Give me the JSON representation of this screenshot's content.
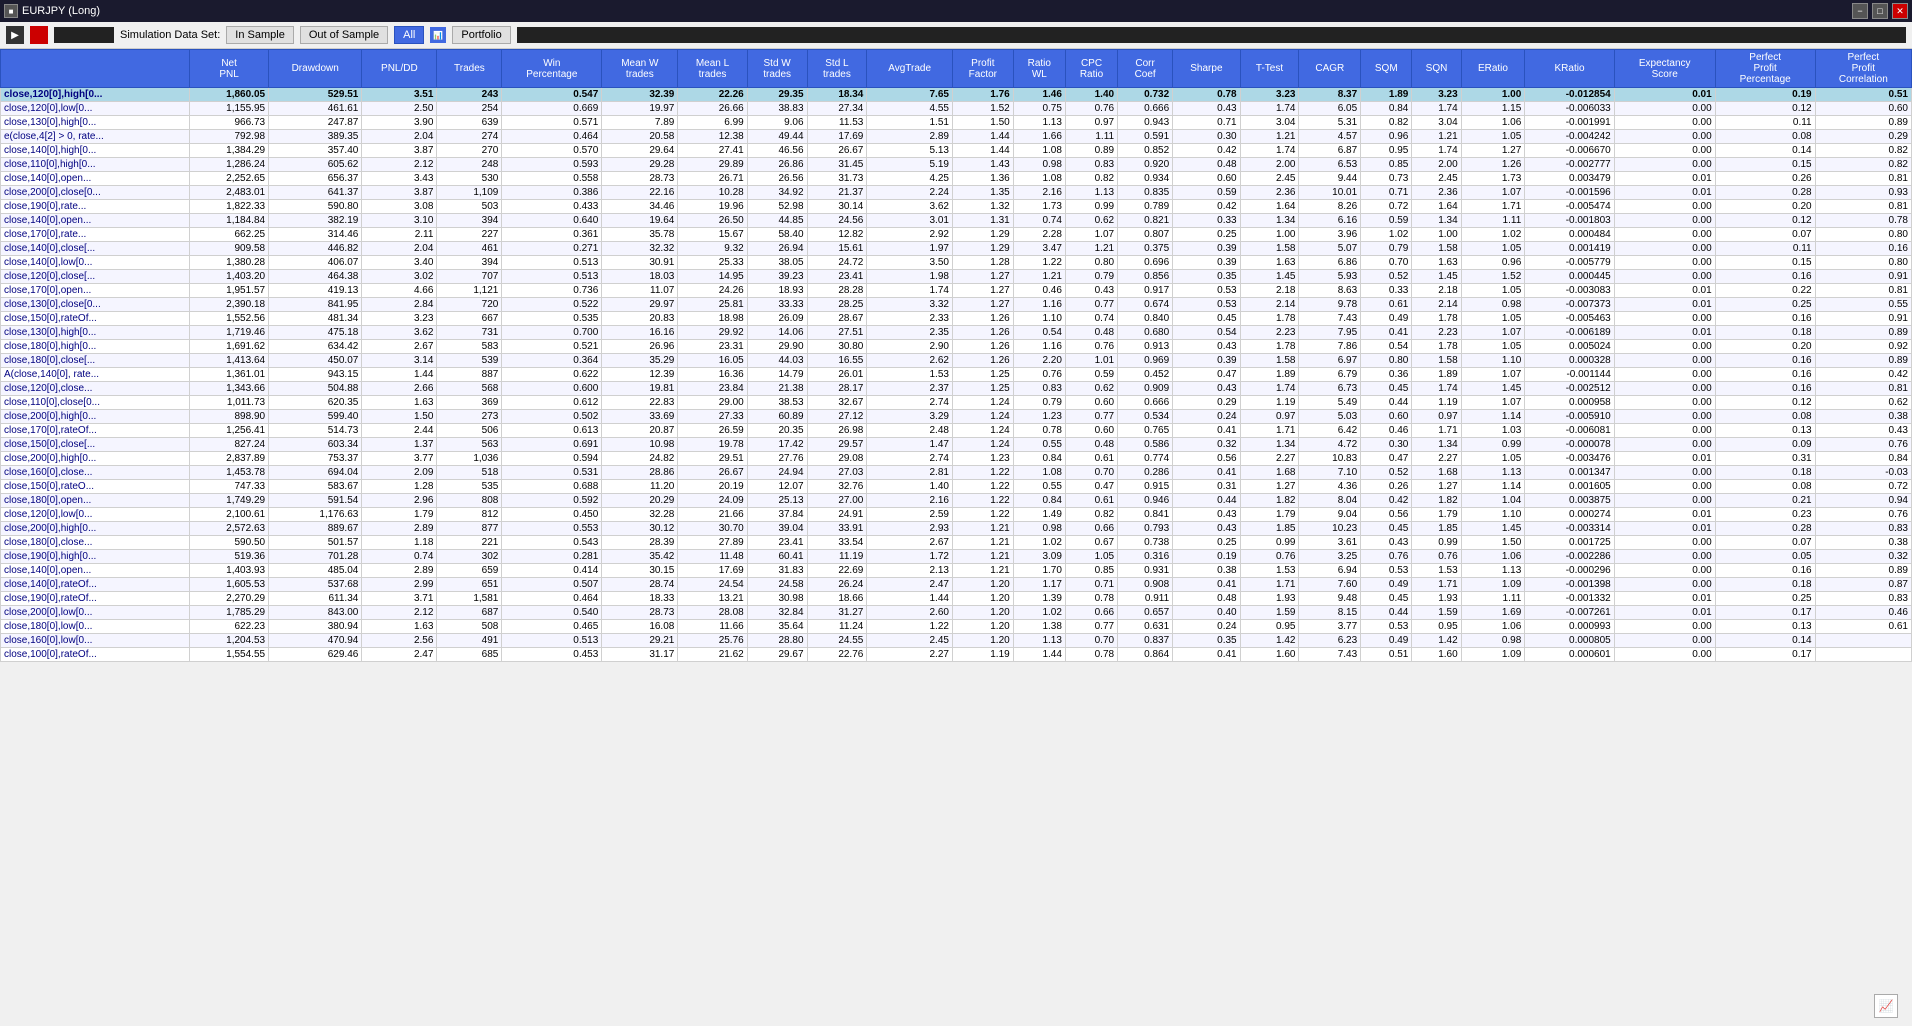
{
  "window": {
    "title": "EURJPY (Long)",
    "minimize_label": "−",
    "restore_label": "□",
    "close_label": "✕"
  },
  "toolbar": {
    "play_icon": "▶",
    "stop_color": "#cc0000",
    "sim_label": "Simulation Data Set:",
    "in_sample_label": "In Sample",
    "out_of_sample_label": "Out of Sample",
    "all_label": "All",
    "portfolio_label": "Portfolio"
  },
  "columns": [
    {
      "id": "strategy",
      "label": "",
      "sub": ""
    },
    {
      "id": "net_pnl",
      "label": "Net PNL",
      "sub": ""
    },
    {
      "id": "drawdown",
      "label": "Drawdown",
      "sub": ""
    },
    {
      "id": "pnl_dd",
      "label": "PNL/DD",
      "sub": ""
    },
    {
      "id": "trades",
      "label": "Trades",
      "sub": ""
    },
    {
      "id": "win_pct",
      "label": "Win Percentage",
      "sub": ""
    },
    {
      "id": "mean_w",
      "label": "Mean W trades",
      "sub": ""
    },
    {
      "id": "mean_l",
      "label": "Mean L trades",
      "sub": ""
    },
    {
      "id": "std_w",
      "label": "Std W trades",
      "sub": ""
    },
    {
      "id": "std_l",
      "label": "Std L trades",
      "sub": ""
    },
    {
      "id": "avg_trade",
      "label": "AvgTrade",
      "sub": ""
    },
    {
      "id": "profit_factor",
      "label": "Profit Factor",
      "sub": ""
    },
    {
      "id": "ratio_wl",
      "label": "Ratio WL",
      "sub": ""
    },
    {
      "id": "cpc_ratio",
      "label": "CPC Ratio",
      "sub": ""
    },
    {
      "id": "corr_coef",
      "label": "Corr Coef",
      "sub": ""
    },
    {
      "id": "sharpe",
      "label": "Sharpe",
      "sub": ""
    },
    {
      "id": "t_test",
      "label": "T-Test",
      "sub": ""
    },
    {
      "id": "cagr",
      "label": "CAGR",
      "sub": ""
    },
    {
      "id": "sqm",
      "label": "SQM",
      "sub": ""
    },
    {
      "id": "sqn",
      "label": "SQN",
      "sub": ""
    },
    {
      "id": "eratio",
      "label": "ERatio",
      "sub": ""
    },
    {
      "id": "kratio",
      "label": "KRatio",
      "sub": ""
    },
    {
      "id": "expectancy",
      "label": "Expectancy Score",
      "sub": ""
    },
    {
      "id": "perf_profit_pct",
      "label": "Perfect Profit Percentage",
      "sub": ""
    },
    {
      "id": "perf_profit_corr",
      "label": "Perfect Profit Correlation",
      "sub": ""
    }
  ],
  "rows": [
    [
      "close,120[0],high[0...",
      "1,860.05",
      "529.51",
      "3.51",
      "243",
      "0.547",
      "32.39",
      "22.26",
      "29.35",
      "18.34",
      "7.65",
      "1.76",
      "1.46",
      "1.40",
      "0.732",
      "0.78",
      "3.23",
      "8.37",
      "1.89",
      "3.23",
      "1.00",
      "-0.012854",
      "0.01",
      "0.19",
      "0.51"
    ],
    [
      "close,120[0],low[0...",
      "1,155.95",
      "461.61",
      "2.50",
      "254",
      "0.669",
      "19.97",
      "26.66",
      "38.83",
      "27.34",
      "4.55",
      "1.52",
      "0.75",
      "0.76",
      "0.666",
      "0.43",
      "1.74",
      "6.05",
      "0.84",
      "1.74",
      "1.15",
      "-0.006033",
      "0.00",
      "0.12",
      "0.60"
    ],
    [
      "close,130[0],high[0...",
      "966.73",
      "247.87",
      "3.90",
      "639",
      "0.571",
      "7.89",
      "6.99",
      "9.06",
      "11.53",
      "1.51",
      "1.50",
      "1.13",
      "0.97",
      "0.943",
      "0.71",
      "3.04",
      "5.31",
      "0.82",
      "3.04",
      "1.06",
      "-0.001991",
      "0.00",
      "0.11",
      "0.89"
    ],
    [
      "e(close,4[2] > 0, rate...",
      "792.98",
      "389.35",
      "2.04",
      "274",
      "0.464",
      "20.58",
      "12.38",
      "49.44",
      "17.69",
      "2.89",
      "1.44",
      "1.66",
      "1.11",
      "0.591",
      "0.30",
      "1.21",
      "4.57",
      "0.96",
      "1.21",
      "1.05",
      "-0.004242",
      "0.00",
      "0.08",
      "0.29"
    ],
    [
      "close,140[0],high[0...",
      "1,384.29",
      "357.40",
      "3.87",
      "270",
      "0.570",
      "29.64",
      "27.41",
      "46.56",
      "26.67",
      "5.13",
      "1.44",
      "1.08",
      "0.89",
      "0.852",
      "0.42",
      "1.74",
      "6.87",
      "0.95",
      "1.74",
      "1.27",
      "-0.006670",
      "0.00",
      "0.14",
      "0.82"
    ],
    [
      "close,110[0],high[0...",
      "1,286.24",
      "605.62",
      "2.12",
      "248",
      "0.593",
      "29.28",
      "29.89",
      "26.86",
      "31.45",
      "5.19",
      "1.43",
      "0.98",
      "0.83",
      "0.920",
      "0.48",
      "2.00",
      "6.53",
      "0.85",
      "2.00",
      "1.26",
      "-0.002777",
      "0.00",
      "0.15",
      "0.82"
    ],
    [
      "close,140[0],open...",
      "2,252.65",
      "656.37",
      "3.43",
      "530",
      "0.558",
      "28.73",
      "26.71",
      "26.56",
      "31.73",
      "4.25",
      "1.36",
      "1.08",
      "0.82",
      "0.934",
      "0.60",
      "2.45",
      "9.44",
      "0.73",
      "2.45",
      "1.73",
      "0.003479",
      "0.01",
      "0.26",
      "0.81"
    ],
    [
      "close,200[0],close[0...",
      "2,483.01",
      "641.37",
      "3.87",
      "1,109",
      "0.386",
      "22.16",
      "10.28",
      "34.92",
      "21.37",
      "2.24",
      "1.35",
      "2.16",
      "1.13",
      "0.835",
      "0.59",
      "2.36",
      "10.01",
      "0.71",
      "2.36",
      "1.07",
      "-0.001596",
      "0.01",
      "0.28",
      "0.93"
    ],
    [
      "close,190[0],rate...",
      "1,822.33",
      "590.80",
      "3.08",
      "503",
      "0.433",
      "34.46",
      "19.96",
      "52.98",
      "30.14",
      "3.62",
      "1.32",
      "1.73",
      "0.99",
      "0.789",
      "0.42",
      "1.64",
      "8.26",
      "0.72",
      "1.64",
      "1.71",
      "-0.005474",
      "0.00",
      "0.20",
      "0.81"
    ],
    [
      "close,140[0],open...",
      "1,184.84",
      "382.19",
      "3.10",
      "394",
      "0.640",
      "19.64",
      "26.50",
      "44.85",
      "24.56",
      "3.01",
      "1.31",
      "0.74",
      "0.62",
      "0.821",
      "0.33",
      "1.34",
      "6.16",
      "0.59",
      "1.34",
      "1.11",
      "-0.001803",
      "0.00",
      "0.12",
      "0.78"
    ],
    [
      "close,170[0],rate...",
      "662.25",
      "314.46",
      "2.11",
      "227",
      "0.361",
      "35.78",
      "15.67",
      "58.40",
      "12.82",
      "2.92",
      "1.29",
      "2.28",
      "1.07",
      "0.807",
      "0.25",
      "1.00",
      "3.96",
      "1.02",
      "1.00",
      "1.02",
      "0.000484",
      "0.00",
      "0.07",
      "0.80"
    ],
    [
      "close,140[0],close[...",
      "909.58",
      "446.82",
      "2.04",
      "461",
      "0.271",
      "32.32",
      "9.32",
      "26.94",
      "15.61",
      "1.97",
      "1.29",
      "3.47",
      "1.21",
      "0.375",
      "0.39",
      "1.58",
      "5.07",
      "0.79",
      "1.58",
      "1.05",
      "0.001419",
      "0.00",
      "0.11",
      "0.16"
    ],
    [
      "close,140[0],low[0...",
      "1,380.28",
      "406.07",
      "3.40",
      "394",
      "0.513",
      "30.91",
      "25.33",
      "38.05",
      "24.72",
      "3.50",
      "1.28",
      "1.22",
      "0.80",
      "0.696",
      "0.39",
      "1.63",
      "6.86",
      "0.70",
      "1.63",
      "0.96",
      "-0.005779",
      "0.00",
      "0.15",
      "0.80"
    ],
    [
      "close,120[0],close[...",
      "1,403.20",
      "464.38",
      "3.02",
      "707",
      "0.513",
      "18.03",
      "14.95",
      "39.23",
      "23.41",
      "1.98",
      "1.27",
      "1.21",
      "0.79",
      "0.856",
      "0.35",
      "1.45",
      "5.93",
      "0.52",
      "1.45",
      "1.52",
      "0.000445",
      "0.00",
      "0.16",
      "0.91"
    ],
    [
      "close,170[0],open...",
      "1,951.57",
      "419.13",
      "4.66",
      "1,121",
      "0.736",
      "11.07",
      "24.26",
      "18.93",
      "28.28",
      "1.74",
      "1.27",
      "0.46",
      "0.43",
      "0.917",
      "0.53",
      "2.18",
      "8.63",
      "0.33",
      "2.18",
      "1.05",
      "-0.003083",
      "0.01",
      "0.22",
      "0.81"
    ],
    [
      "close,130[0],close[0...",
      "2,390.18",
      "841.95",
      "2.84",
      "720",
      "0.522",
      "29.97",
      "25.81",
      "33.33",
      "28.25",
      "3.32",
      "1.27",
      "1.16",
      "0.77",
      "0.674",
      "0.53",
      "2.14",
      "9.78",
      "0.61",
      "2.14",
      "0.98",
      "-0.007373",
      "0.01",
      "0.25",
      "0.55"
    ],
    [
      "close,150[0],rateOf...",
      "1,552.56",
      "481.34",
      "3.23",
      "667",
      "0.535",
      "20.83",
      "18.98",
      "26.09",
      "28.67",
      "2.33",
      "1.26",
      "1.10",
      "0.74",
      "0.840",
      "0.45",
      "1.78",
      "7.43",
      "0.49",
      "1.78",
      "1.05",
      "-0.005463",
      "0.00",
      "0.16",
      "0.91"
    ],
    [
      "close,130[0],high[0...",
      "1,719.46",
      "475.18",
      "3.62",
      "731",
      "0.700",
      "16.16",
      "29.92",
      "14.06",
      "27.51",
      "2.35",
      "1.26",
      "0.54",
      "0.48",
      "0.680",
      "0.54",
      "2.23",
      "7.95",
      "0.41",
      "2.23",
      "1.07",
      "-0.006189",
      "0.01",
      "0.18",
      "0.89"
    ],
    [
      "close,180[0],high[0...",
      "1,691.62",
      "634.42",
      "2.67",
      "583",
      "0.521",
      "26.96",
      "23.31",
      "29.90",
      "30.80",
      "2.90",
      "1.26",
      "1.16",
      "0.76",
      "0.913",
      "0.43",
      "1.78",
      "7.86",
      "0.54",
      "1.78",
      "1.05",
      "0.005024",
      "0.00",
      "0.20",
      "0.92"
    ],
    [
      "close,180[0],close[...",
      "1,413.64",
      "450.07",
      "3.14",
      "539",
      "0.364",
      "35.29",
      "16.05",
      "44.03",
      "16.55",
      "2.62",
      "1.26",
      "2.20",
      "1.01",
      "0.969",
      "0.39",
      "1.58",
      "6.97",
      "0.80",
      "1.58",
      "1.10",
      "0.000328",
      "0.00",
      "0.16",
      "0.89"
    ],
    [
      "A(close,140[0], rate...",
      "1,361.01",
      "943.15",
      "1.44",
      "887",
      "0.622",
      "12.39",
      "16.36",
      "14.79",
      "26.01",
      "1.53",
      "1.25",
      "0.76",
      "0.59",
      "0.452",
      "0.47",
      "1.89",
      "6.79",
      "0.36",
      "1.89",
      "1.07",
      "-0.001144",
      "0.00",
      "0.16",
      "0.42"
    ],
    [
      "close,120[0],close...",
      "1,343.66",
      "504.88",
      "2.66",
      "568",
      "0.600",
      "19.81",
      "23.84",
      "21.38",
      "28.17",
      "2.37",
      "1.25",
      "0.83",
      "0.62",
      "0.909",
      "0.43",
      "1.74",
      "6.73",
      "0.45",
      "1.74",
      "1.45",
      "-0.002512",
      "0.00",
      "0.16",
      "0.81"
    ],
    [
      "close,110[0],close[0...",
      "1,011.73",
      "620.35",
      "1.63",
      "369",
      "0.612",
      "22.83",
      "29.00",
      "38.53",
      "32.67",
      "2.74",
      "1.24",
      "0.79",
      "0.60",
      "0.666",
      "0.29",
      "1.19",
      "5.49",
      "0.44",
      "1.19",
      "1.07",
      "0.000958",
      "0.00",
      "0.12",
      "0.62"
    ],
    [
      "close,200[0],high[0...",
      "898.90",
      "599.40",
      "1.50",
      "273",
      "0.502",
      "33.69",
      "27.33",
      "60.89",
      "27.12",
      "3.29",
      "1.24",
      "1.23",
      "0.77",
      "0.534",
      "0.24",
      "0.97",
      "5.03",
      "0.60",
      "0.97",
      "1.14",
      "-0.005910",
      "0.00",
      "0.08",
      "0.38"
    ],
    [
      "close,170[0],rateOf...",
      "1,256.41",
      "514.73",
      "2.44",
      "506",
      "0.613",
      "20.87",
      "26.59",
      "20.35",
      "26.98",
      "2.48",
      "1.24",
      "0.78",
      "0.60",
      "0.765",
      "0.41",
      "1.71",
      "6.42",
      "0.46",
      "1.71",
      "1.03",
      "-0.006081",
      "0.00",
      "0.13",
      "0.43"
    ],
    [
      "close,150[0],close[...",
      "827.24",
      "603.34",
      "1.37",
      "563",
      "0.691",
      "10.98",
      "19.78",
      "17.42",
      "29.57",
      "1.47",
      "1.24",
      "0.55",
      "0.48",
      "0.586",
      "0.32",
      "1.34",
      "4.72",
      "0.30",
      "1.34",
      "0.99",
      "-0.000078",
      "0.00",
      "0.09",
      "0.76"
    ],
    [
      "close,200[0],high[0...",
      "2,837.89",
      "753.37",
      "3.77",
      "1,036",
      "0.594",
      "24.82",
      "29.51",
      "27.76",
      "29.08",
      "2.74",
      "1.23",
      "0.84",
      "0.61",
      "0.774",
      "0.56",
      "2.27",
      "10.83",
      "0.47",
      "2.27",
      "1.05",
      "-0.003476",
      "0.01",
      "0.31",
      "0.84"
    ],
    [
      "close,160[0],close...",
      "1,453.78",
      "694.04",
      "2.09",
      "518",
      "0.531",
      "28.86",
      "26.67",
      "24.94",
      "27.03",
      "2.81",
      "1.22",
      "1.08",
      "0.70",
      "0.286",
      "0.41",
      "1.68",
      "7.10",
      "0.52",
      "1.68",
      "1.13",
      "0.001347",
      "0.00",
      "0.18",
      "-0.03"
    ],
    [
      "close,150[0],rateO...",
      "747.33",
      "583.67",
      "1.28",
      "535",
      "0.688",
      "11.20",
      "20.19",
      "12.07",
      "32.76",
      "1.40",
      "1.22",
      "0.55",
      "0.47",
      "0.915",
      "0.31",
      "1.27",
      "4.36",
      "0.26",
      "1.27",
      "1.14",
      "0.001605",
      "0.00",
      "0.08",
      "0.72"
    ],
    [
      "close,180[0],open...",
      "1,749.29",
      "591.54",
      "2.96",
      "808",
      "0.592",
      "20.29",
      "24.09",
      "25.13",
      "27.00",
      "2.16",
      "1.22",
      "0.84",
      "0.61",
      "0.946",
      "0.44",
      "1.82",
      "8.04",
      "0.42",
      "1.82",
      "1.04",
      "0.003875",
      "0.00",
      "0.21",
      "0.94"
    ],
    [
      "close,120[0],low[0...",
      "2,100.61",
      "1,176.63",
      "1.79",
      "812",
      "0.450",
      "32.28",
      "21.66",
      "37.84",
      "24.91",
      "2.59",
      "1.22",
      "1.49",
      "0.82",
      "0.841",
      "0.43",
      "1.79",
      "9.04",
      "0.56",
      "1.79",
      "1.10",
      "0.000274",
      "0.01",
      "0.23",
      "0.76"
    ],
    [
      "close,200[0],high[0...",
      "2,572.63",
      "889.67",
      "2.89",
      "877",
      "0.553",
      "30.12",
      "30.70",
      "39.04",
      "33.91",
      "2.93",
      "1.21",
      "0.98",
      "0.66",
      "0.793",
      "0.43",
      "1.85",
      "10.23",
      "0.45",
      "1.85",
      "1.45",
      "-0.003314",
      "0.01",
      "0.28",
      "0.83"
    ],
    [
      "close,180[0],close...",
      "590.50",
      "501.57",
      "1.18",
      "221",
      "0.543",
      "28.39",
      "27.89",
      "23.41",
      "33.54",
      "2.67",
      "1.21",
      "1.02",
      "0.67",
      "0.738",
      "0.25",
      "0.99",
      "3.61",
      "0.43",
      "0.99",
      "1.50",
      "0.001725",
      "0.00",
      "0.07",
      "0.38"
    ],
    [
      "close,190[0],high[0...",
      "519.36",
      "701.28",
      "0.74",
      "302",
      "0.281",
      "35.42",
      "11.48",
      "60.41",
      "11.19",
      "1.72",
      "1.21",
      "3.09",
      "1.05",
      "0.316",
      "0.19",
      "0.76",
      "3.25",
      "0.76",
      "0.76",
      "1.06",
      "-0.002286",
      "0.00",
      "0.05",
      "0.32"
    ],
    [
      "close,140[0],open...",
      "1,403.93",
      "485.04",
      "2.89",
      "659",
      "0.414",
      "30.15",
      "17.69",
      "31.83",
      "22.69",
      "2.13",
      "1.21",
      "1.70",
      "0.85",
      "0.931",
      "0.38",
      "1.53",
      "6.94",
      "0.53",
      "1.53",
      "1.13",
      "-0.000296",
      "0.00",
      "0.16",
      "0.89"
    ],
    [
      "close,140[0],rateOf...",
      "1,605.53",
      "537.68",
      "2.99",
      "651",
      "0.507",
      "28.74",
      "24.54",
      "24.58",
      "26.24",
      "2.47",
      "1.20",
      "1.17",
      "0.71",
      "0.908",
      "0.41",
      "1.71",
      "7.60",
      "0.49",
      "1.71",
      "1.09",
      "-0.001398",
      "0.00",
      "0.18",
      "0.87"
    ],
    [
      "close,190[0],rateOf...",
      "2,270.29",
      "611.34",
      "3.71",
      "1,581",
      "0.464",
      "18.33",
      "13.21",
      "30.98",
      "18.66",
      "1.44",
      "1.20",
      "1.39",
      "0.78",
      "0.911",
      "0.48",
      "1.93",
      "9.48",
      "0.45",
      "1.93",
      "1.11",
      "-0.001332",
      "0.01",
      "0.25",
      "0.83"
    ],
    [
      "close,200[0],low[0...",
      "1,785.29",
      "843.00",
      "2.12",
      "687",
      "0.540",
      "28.73",
      "28.08",
      "32.84",
      "31.27",
      "2.60",
      "1.20",
      "1.02",
      "0.66",
      "0.657",
      "0.40",
      "1.59",
      "8.15",
      "0.44",
      "1.59",
      "1.69",
      "-0.007261",
      "0.01",
      "0.17",
      "0.46"
    ],
    [
      "close,180[0],low[0...",
      "622.23",
      "380.94",
      "1.63",
      "508",
      "0.465",
      "16.08",
      "11.66",
      "35.64",
      "11.24",
      "1.22",
      "1.20",
      "1.38",
      "0.77",
      "0.631",
      "0.24",
      "0.95",
      "3.77",
      "0.53",
      "0.95",
      "1.06",
      "0.000993",
      "0.00",
      "0.13",
      "0.61"
    ],
    [
      "close,160[0],low[0...",
      "1,204.53",
      "470.94",
      "2.56",
      "491",
      "0.513",
      "29.21",
      "25.76",
      "28.80",
      "24.55",
      "2.45",
      "1.20",
      "1.13",
      "0.70",
      "0.837",
      "0.35",
      "1.42",
      "6.23",
      "0.49",
      "1.42",
      "0.98",
      "0.000805",
      "0.00",
      "0.14",
      ""
    ],
    [
      "close,100[0],rateOf...",
      "1,554.55",
      "629.46",
      "2.47",
      "685",
      "0.453",
      "31.17",
      "21.62",
      "29.67",
      "22.76",
      "2.27",
      "1.19",
      "1.44",
      "0.78",
      "0.864",
      "0.41",
      "1.60",
      "7.43",
      "0.51",
      "1.60",
      "1.09",
      "0.000601",
      "0.00",
      "0.17",
      ""
    ]
  ]
}
